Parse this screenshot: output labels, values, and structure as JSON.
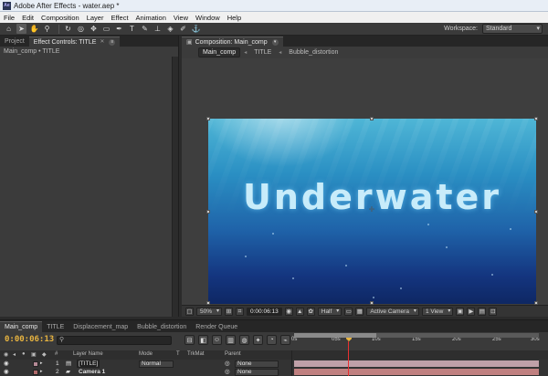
{
  "window": {
    "title": "Adobe After Effects - water.aep *",
    "app_icon": "Ae"
  },
  "menu": [
    "File",
    "Edit",
    "Composition",
    "Layer",
    "Effect",
    "Animation",
    "View",
    "Window",
    "Help"
  ],
  "toolbar": {
    "tools": [
      "home-icon",
      "selection-icon",
      "hand-icon",
      "zoom-icon",
      "rotate-icon",
      "camera-orbit-icon",
      "pan-behind-icon",
      "rectangle-icon",
      "pen-icon",
      "type-icon",
      "brush-icon",
      "clone-stamp-icon",
      "eraser-icon",
      "roto-brush-icon",
      "puppet-pin-icon"
    ],
    "workspace_label": "Workspace:",
    "workspace_value": "Standard"
  },
  "left_panel": {
    "tabs": [
      {
        "label": "Project"
      },
      {
        "label": "Effect Controls: TITLE"
      }
    ],
    "subheader": "Main_comp • TITLE"
  },
  "comp_panel": {
    "tab": "Composition: Main_comp",
    "breadcrumbs": [
      "Main_comp",
      "TITLE",
      "Bubble_distortion"
    ],
    "scene_text": "Underwater",
    "footer": {
      "zoom": "50%",
      "timecode": "0:00:06:13",
      "resolution": "Half",
      "camera": "Active Camera",
      "views": "1 View"
    }
  },
  "timeline": {
    "tabs": [
      "Main_comp",
      "TITLE",
      "Displacement_map",
      "Bubble_distortion",
      "Render Queue"
    ],
    "current_time": "0:00:06:13",
    "search_placeholder": "",
    "ruler": [
      "0s",
      "05s",
      "10s",
      "15s",
      "20s",
      "25s",
      "30s"
    ],
    "columns": {
      "num": "#",
      "layer_name": "Layer Name",
      "mode": "Mode",
      "t": "T",
      "trkmat": "TrkMat",
      "parent": "Parent"
    },
    "layers": [
      {
        "num": "1",
        "name": "[TITLE]",
        "mode": "Normal",
        "parent": "None",
        "label_color": "#c0a0a8"
      },
      {
        "num": "2",
        "name": "Camera 1",
        "mode": "",
        "parent": "None",
        "label_color": "#c08080"
      }
    ]
  },
  "colors": {
    "accent": "#e8b440",
    "playhead_line": "#e83030",
    "bg": "#333333"
  }
}
